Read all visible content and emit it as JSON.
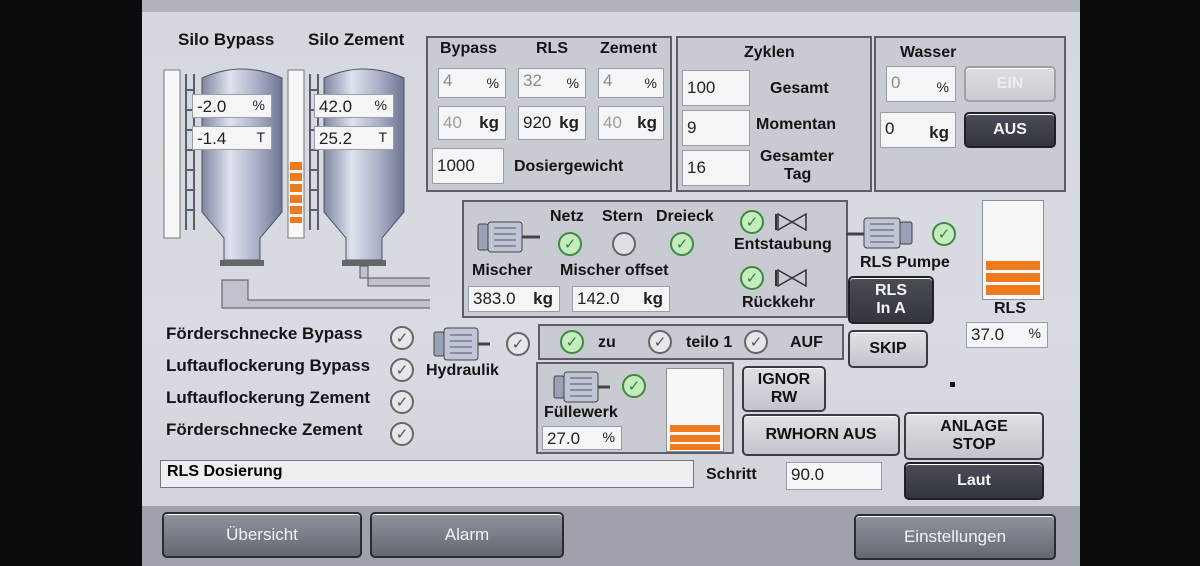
{
  "silo_bypass": {
    "title": "Silo Bypass",
    "percent_value": "-2.0",
    "percent_unit": "%",
    "tons_value": "-1.4",
    "tons_unit": "T"
  },
  "silo_zement": {
    "title": "Silo Zement",
    "percent_value": "42.0",
    "percent_unit": "%",
    "tons_value": "25.2",
    "tons_unit": "T",
    "level_fraction": 0.42
  },
  "dosing": {
    "headers": [
      "Bypass",
      "RLS",
      "Zement"
    ],
    "percent": [
      {
        "value": "4",
        "unit": "%"
      },
      {
        "value": "32",
        "unit": "%"
      },
      {
        "value": "4",
        "unit": "%"
      }
    ],
    "kg": [
      {
        "value": "40",
        "unit": "kg"
      },
      {
        "value": "920",
        "unit": "kg"
      },
      {
        "value": "40",
        "unit": "kg"
      }
    ],
    "dosiergewicht_value": "1000",
    "dosiergewicht_label": "Dosiergewicht"
  },
  "zyklen": {
    "title": "Zyklen",
    "gesamt_value": "100",
    "gesamt_label": "Gesamt",
    "momentan_value": "9",
    "momentan_label": "Momentan",
    "tag_value": "16",
    "tag_label_1": "Gesamter",
    "tag_label_2": "Tag"
  },
  "wasser": {
    "title": "Wasser",
    "percent_value": "0",
    "percent_unit": "%",
    "kg_value": "0",
    "kg_unit": "kg",
    "ein_label": "EIN",
    "aus_label": "AUS"
  },
  "mischer": {
    "netz_label": "Netz",
    "stern_label": "Stern",
    "dreieck_label": "Dreieck",
    "mischer_label": "Mischer",
    "mischer_value": "383.0",
    "mischer_unit": "kg",
    "offset_label": "Mischer offset",
    "offset_value": "142.0",
    "offset_unit": "kg",
    "entstaubung_label": "Entstaubung",
    "rueckkehr_label": "Rückkehr"
  },
  "rls": {
    "pumpe_label": "RLS Pumpe",
    "in_a_label_1": "RLS",
    "in_a_label_2": "In A",
    "skip_label": "SKIP",
    "tank_label": "RLS",
    "percent_value": "37.0",
    "percent_unit": "%",
    "level_fraction": 0.37
  },
  "conveyors": [
    {
      "label": "Förderschnecke Bypass"
    },
    {
      "label": "Luftauflockerung Bypass"
    },
    {
      "label": "Luftauflockerung Zement"
    },
    {
      "label": "Förderschnecke Zement"
    }
  ],
  "hydraulik": {
    "label": "Hydraulik"
  },
  "valve": {
    "zu_label": "zu",
    "teilo_label": "teilo 1",
    "auf_label": "AUF"
  },
  "fuellwerk": {
    "label": "Füllewerk",
    "percent_value": "27.0",
    "percent_unit": "%",
    "level_fraction": 0.27
  },
  "buttons": {
    "ignor_1": "IGNOR",
    "ignor_2": "RW",
    "rwhorn": "RWHORN AUS",
    "anlage_1": "ANLAGE",
    "anlage_2": "STOP",
    "laut": "Laut"
  },
  "status": {
    "text": "RLS Dosierung",
    "schritt_label": "Schritt",
    "schritt_value": "90.0"
  },
  "nav": {
    "uebersicht": "Übersicht",
    "alarm": "Alarm",
    "einstellungen": "Einstellungen"
  },
  "colors": {
    "accent_orange": "#ee7a1e",
    "ok_green": "#3e8a3e",
    "dark_button": "#3a3d44",
    "screen_bg": "#d6d8df"
  }
}
